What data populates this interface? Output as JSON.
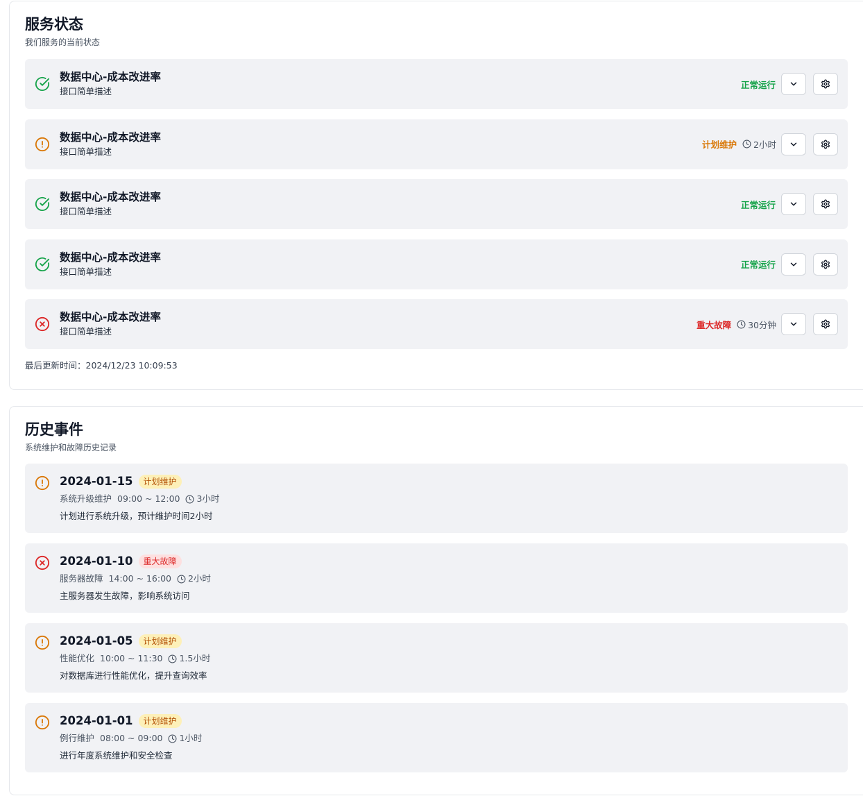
{
  "colors": {
    "operational": "#16a34a",
    "maintenance": "#d97706",
    "major_outage": "#dc2626"
  },
  "status_section": {
    "title": "服务状态",
    "subtitle": "我们服务的当前状态",
    "services": [
      {
        "name": "数据中心-成本改进率",
        "description": "接口简单描述",
        "status": "正常运行",
        "status_type": "operational",
        "icon": "check-circle-icon",
        "duration": ""
      },
      {
        "name": "数据中心-成本改进率",
        "description": "接口简单描述",
        "status": "计划维护",
        "status_type": "maintenance",
        "icon": "alert-circle-icon",
        "duration": "2小时"
      },
      {
        "name": "数据中心-成本改进率",
        "description": "接口简单描述",
        "status": "正常运行",
        "status_type": "operational",
        "icon": "check-circle-icon",
        "duration": ""
      },
      {
        "name": "数据中心-成本改进率",
        "description": "接口简单描述",
        "status": "正常运行",
        "status_type": "operational",
        "icon": "check-circle-icon",
        "duration": ""
      },
      {
        "name": "数据中心-成本改进率",
        "description": "接口简单描述",
        "status": "重大故障",
        "status_type": "major_outage",
        "icon": "x-circle-icon",
        "duration": "30分钟"
      }
    ],
    "last_updated": "最后更新时间：2024/12/23 10:09:53"
  },
  "history_section": {
    "title": "历史事件",
    "subtitle": "系统维护和故障历史记录",
    "events": [
      {
        "date": "2024-01-15",
        "badge": "计划维护",
        "type": "maintenance",
        "icon": "alert-circle-icon",
        "name": "系统升级维护",
        "time_range": "09:00 ~ 12:00",
        "duration": "3小时",
        "description": "计划进行系统升级，预计维护时间2小时"
      },
      {
        "date": "2024-01-10",
        "badge": "重大故障",
        "type": "major_outage",
        "icon": "x-circle-icon",
        "name": "服务器故障",
        "time_range": "14:00 ~ 16:00",
        "duration": "2小时",
        "description": "主服务器发生故障，影响系统访问"
      },
      {
        "date": "2024-01-05",
        "badge": "计划维护",
        "type": "maintenance",
        "icon": "alert-circle-icon",
        "name": "性能优化",
        "time_range": "10:00 ~ 11:30",
        "duration": "1.5小时",
        "description": "对数据库进行性能优化，提升查询效率"
      },
      {
        "date": "2024-01-01",
        "badge": "计划维护",
        "type": "maintenance",
        "icon": "alert-circle-icon",
        "name": "例行维护",
        "time_range": "08:00 ~ 09:00",
        "duration": "1小时",
        "description": "进行年度系统维护和安全检查"
      }
    ]
  }
}
